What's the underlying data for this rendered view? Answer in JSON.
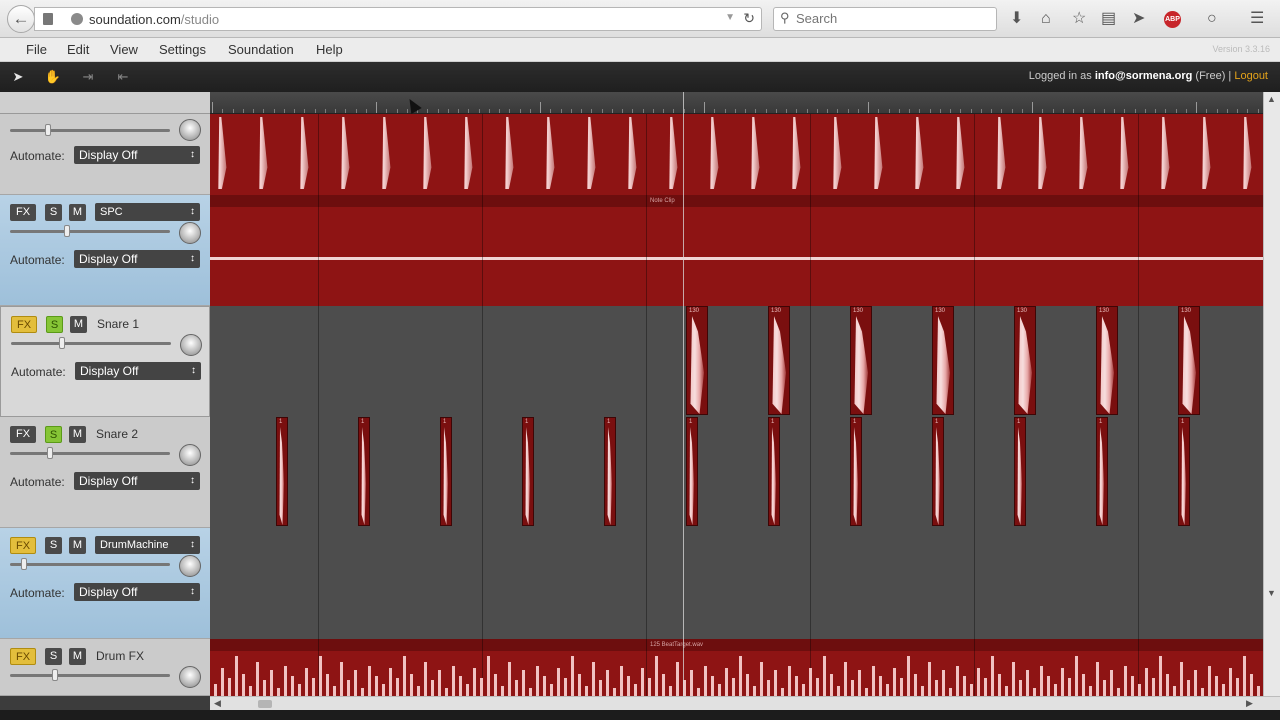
{
  "browser": {
    "url_host": "soundation.com",
    "url_path": "/studio",
    "search_placeholder": "Search",
    "abp_label": "ABP"
  },
  "menu": {
    "items": [
      "File",
      "Edit",
      "View",
      "Settings",
      "Soundation",
      "Help"
    ],
    "version": "Version 3.3.16"
  },
  "toolbar": {
    "logged_in_text": "Logged in as",
    "user": "info@sormena.org",
    "plan": "(Free) |",
    "logout": "Logout"
  },
  "tracks": [
    {
      "name": "",
      "select": null,
      "fx_on": false,
      "solo_on": false,
      "automate_label": "Automate:",
      "automate_value": "Display Off",
      "volume": 0.23
    },
    {
      "name": "",
      "select": "SPC",
      "fx_on": false,
      "solo_on": false,
      "automate_label": "Automate:",
      "automate_value": "Display Off",
      "volume": 0.35
    },
    {
      "name": "Snare 1",
      "select": null,
      "fx_on": true,
      "solo_on": true,
      "automate_label": "Automate:",
      "automate_value": "Display Off",
      "volume": 0.31
    },
    {
      "name": "Snare 2",
      "select": null,
      "fx_on": false,
      "solo_on": true,
      "automate_label": "Automate:",
      "automate_value": "Display Off",
      "volume": 0.24
    },
    {
      "name": "",
      "select": "DrumMachine",
      "fx_on": true,
      "solo_on": false,
      "automate_label": "Automate:",
      "automate_value": "Display Off",
      "volume": 0.07
    },
    {
      "name": "Drum FX",
      "select": null,
      "fx_on": true,
      "solo_on": false,
      "automate_label": "Automate:",
      "automate_value": "",
      "volume": 0.27
    }
  ],
  "buttons": {
    "fx": "FX",
    "solo": "S",
    "mute": "M"
  },
  "clips": {
    "note_clip_label": "Note Clip",
    "drum_fx_label": "125 BeatTarget.wav",
    "snare1_clip_label": "130",
    "snare2_clip_label": "1"
  },
  "colors": {
    "clip_red": "#8e1414",
    "fx_yellow": "#e3be3c",
    "solo_green": "#86c536",
    "logout_orange": "#e3a21a"
  }
}
